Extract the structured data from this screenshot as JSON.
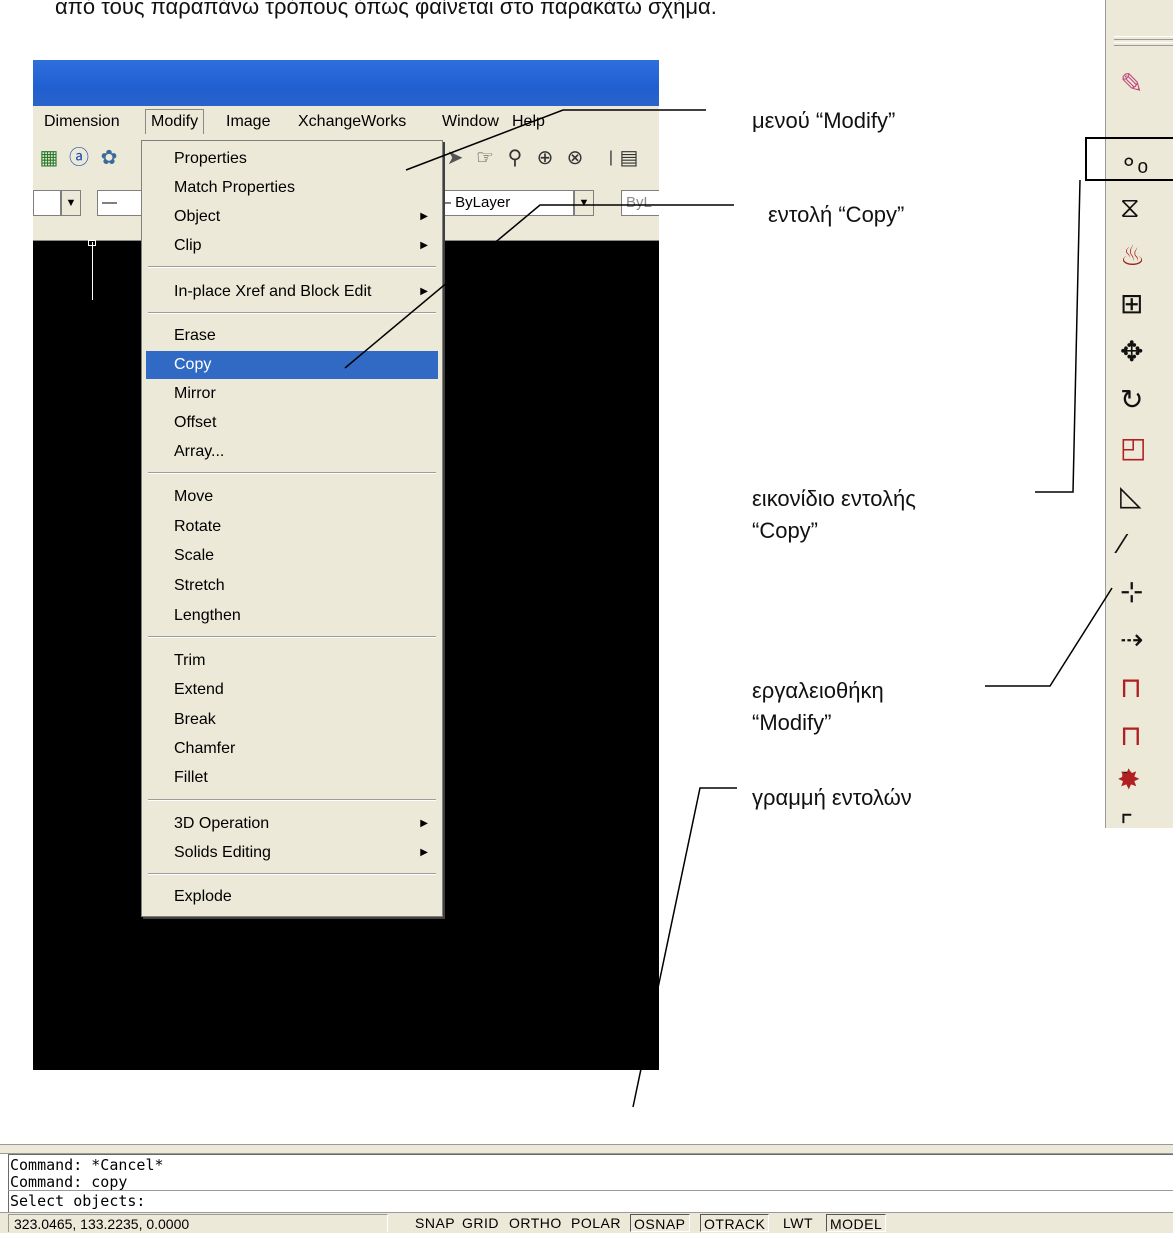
{
  "top_caption": "από τους παραπάνω τρόπους όπως φαίνεται στο παρακάτω σχήμα.",
  "menubar": {
    "items": [
      "Dimension",
      "Modify",
      "Image",
      "XchangeWorks",
      "Window",
      "Help"
    ],
    "active": "Modify"
  },
  "toolbar": {
    "linetype_value": "ByLayer",
    "color_value": "ByL"
  },
  "modify_menu": {
    "items": [
      {
        "label": "Properties"
      },
      {
        "label": "Match Properties"
      },
      {
        "label": "Object",
        "submenu": true
      },
      {
        "label": "Clip",
        "submenu": true
      },
      {
        "label": "In-place Xref and Block Edit",
        "submenu": true
      },
      {
        "label": "Erase"
      },
      {
        "label": "Copy",
        "selected": true
      },
      {
        "label": "Mirror"
      },
      {
        "label": "Offset"
      },
      {
        "label": "Array..."
      },
      {
        "label": "Move"
      },
      {
        "label": "Rotate"
      },
      {
        "label": "Scale"
      },
      {
        "label": "Stretch"
      },
      {
        "label": "Lengthen"
      },
      {
        "label": "Trim"
      },
      {
        "label": "Extend"
      },
      {
        "label": "Break"
      },
      {
        "label": "Chamfer"
      },
      {
        "label": "Fillet"
      },
      {
        "label": "3D Operation",
        "submenu": true
      },
      {
        "label": "Solids Editing",
        "submenu": true
      },
      {
        "label": "Explode"
      }
    ]
  },
  "annotations": {
    "modify_menu": "μενού “Modify”",
    "copy_command": "εντολή “Copy”",
    "copy_icon_line1": "εικονίδιο εντολής",
    "copy_icon_line2": "“Copy”",
    "modify_toolbar_line1": "εργαλειοθήκη",
    "modify_toolbar_line2": "“Modify”",
    "command_line": "γραμμή εντολών"
  },
  "modify_toolbar": {
    "icons": [
      "erase-icon",
      "copy-icon",
      "mirror-icon",
      "offset-icon",
      "array-icon",
      "move-icon",
      "rotate-icon",
      "scale-icon",
      "stretch-icon",
      "lengthen-icon",
      "trim-icon",
      "extend-icon",
      "break-at-point-icon",
      "break-icon",
      "chamfer-icon",
      "fillet-icon",
      "explode-icon"
    ]
  },
  "command_line": {
    "lines": [
      "Command: *Cancel*",
      "Command: copy",
      "Select objects:"
    ]
  },
  "status_bar": {
    "coordinates": "323.0465, 133.2235, 0.0000",
    "toggles": [
      {
        "label": "SNAP",
        "on": false
      },
      {
        "label": "GRID",
        "on": false
      },
      {
        "label": "ORTHO",
        "on": false
      },
      {
        "label": "POLAR",
        "on": false
      },
      {
        "label": "OSNAP",
        "on": true
      },
      {
        "label": "OTRACK",
        "on": true
      },
      {
        "label": "LWT",
        "on": false
      },
      {
        "label": "MODEL",
        "on": true
      }
    ]
  }
}
